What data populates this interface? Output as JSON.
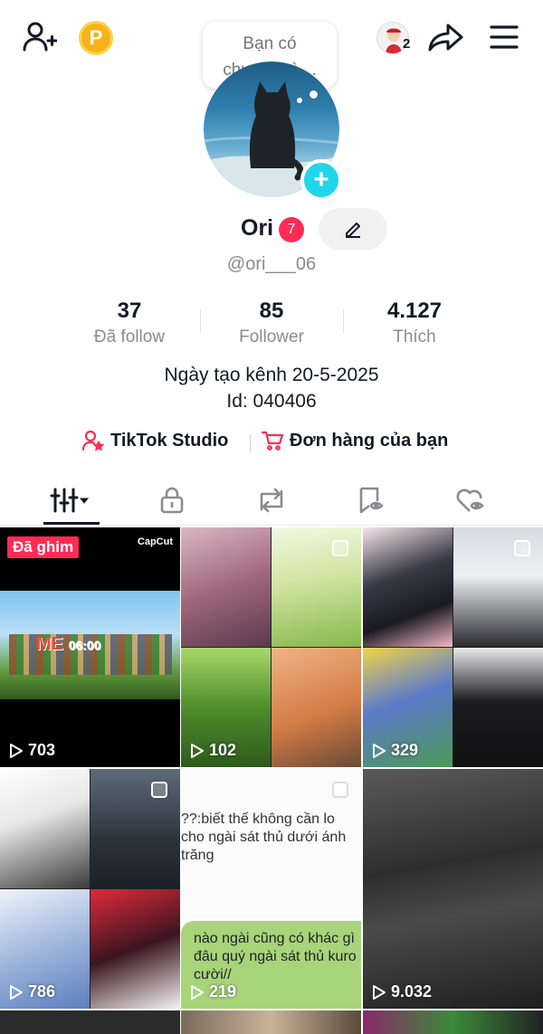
{
  "header": {
    "coin_letter": "P",
    "friends_count": "2"
  },
  "status_bubble": {
    "line1": "Bạn có",
    "line2": "chuyện gì ..."
  },
  "profile": {
    "display_name": "Ori",
    "badge_count": "7",
    "username": "@ori___06",
    "add_symbol": "+"
  },
  "stats": [
    {
      "value": "37",
      "label": "Đã follow"
    },
    {
      "value": "85",
      "label": "Follower"
    },
    {
      "value": "4.127",
      "label": "Thích"
    }
  ],
  "bio": {
    "line1": "Ngày tạo kênh 20-5-2025",
    "line2": "Id: 040406"
  },
  "links": {
    "studio": "TikTok Studio",
    "orders": "Đơn hàng của bạn"
  },
  "tabs": [
    {
      "name": "videos",
      "icon": "grid-icon",
      "active": true
    },
    {
      "name": "private",
      "icon": "lock-icon"
    },
    {
      "name": "reposts",
      "icon": "repost-icon"
    },
    {
      "name": "favorites",
      "icon": "bookmark-icon"
    },
    {
      "name": "liked",
      "icon": "heart-icon"
    }
  ],
  "videos": [
    {
      "views": "703",
      "pinned_label": "Đã ghim",
      "watermark": "CapCut",
      "center_text": "06:00"
    },
    {
      "views": "102"
    },
    {
      "views": "329"
    },
    {
      "views": "786"
    },
    {
      "views": "219",
      "chat_line1": "??:biết thế không cần lo",
      "chat_line2": "cho ngài sát thủ dưới ánh",
      "chat_line3": "trăng",
      "reply_line1": "nào ngài cũng có khác gì",
      "reply_line2": "đâu quý ngài sát thủ kuro",
      "reply_line3": "cười//"
    },
    {
      "views": "9.032"
    }
  ],
  "colors": {
    "accent": "#fe2c55",
    "add_button": "#20d5ec",
    "coin": "#f8b31b"
  }
}
